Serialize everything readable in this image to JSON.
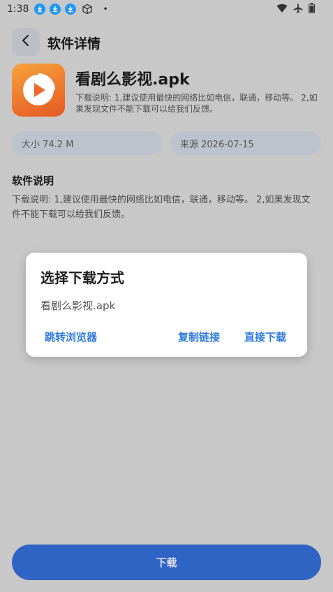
{
  "status_bar": {
    "time": "1:38",
    "dot": "•",
    "icons": [
      "download-icon",
      "download-icon",
      "download-icon",
      "package-icon",
      "wifi-icon",
      "airplane-icon",
      "battery-icon"
    ]
  },
  "header": {
    "title": "软件详情",
    "back_icon": "chevron-left-icon"
  },
  "app": {
    "name": "看剧么影视.apk",
    "description": "下载说明: 1,建议使用最快的网络比如电信，联通，移动等。 2,如果发现文件不能下载可以给我们反馈。",
    "size": "大小 74.2 M",
    "source": "来源 2026-07-15",
    "icon_colors": [
      "#f6a23c",
      "#e65824"
    ]
  },
  "details": {
    "title": "软件说明",
    "body": "下载说明: 1,建议使用最快的网络比如电信，联通，移动等。 2,如果发现文件不能下载可以给我们反馈。"
  },
  "dialog": {
    "title": "选择下载方式",
    "filename": "看剧么影视.apk",
    "buttons": {
      "browser": "跳转浏览器",
      "copy": "复制链接",
      "direct": "直接下载"
    },
    "accent": "#2f7ae0"
  },
  "download_button": {
    "label": "下载",
    "color": "#2f63c4"
  }
}
